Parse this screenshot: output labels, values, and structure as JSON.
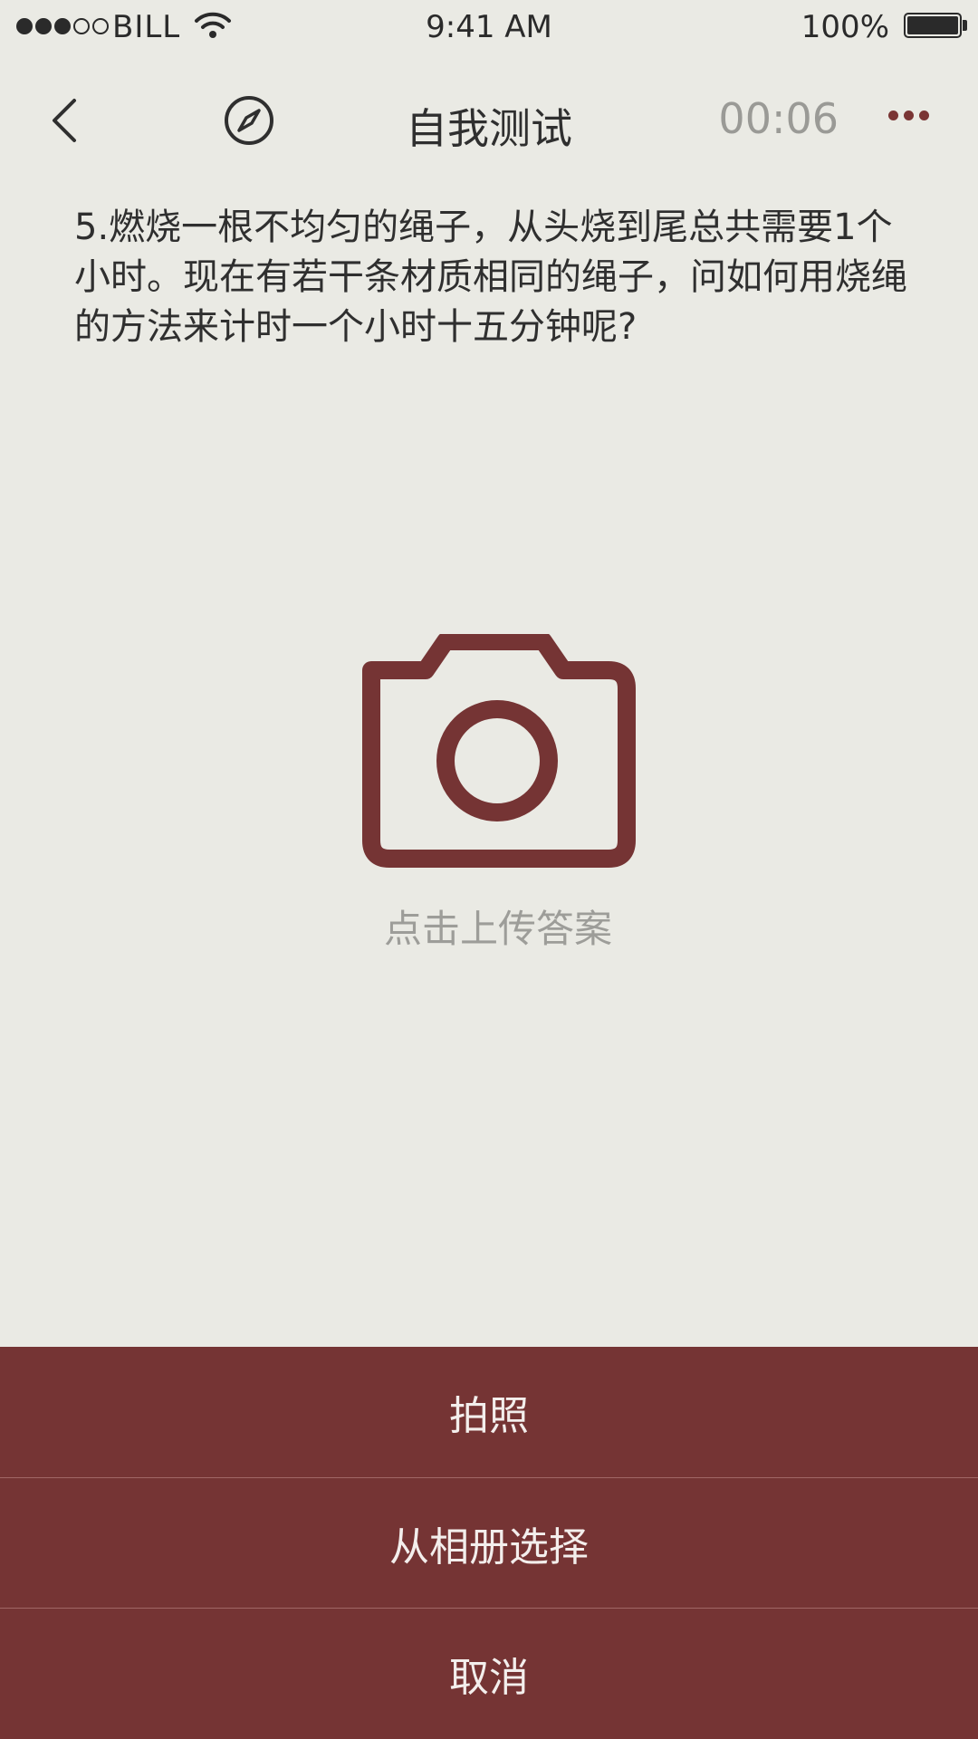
{
  "status_bar": {
    "carrier": "BILL",
    "signal_bars_filled": 3,
    "signal_bars_total": 5,
    "time": "9:41 AM",
    "battery_percent": "100%",
    "battery_level": 1.0
  },
  "nav": {
    "title": "自我测试",
    "timer": "00:06",
    "back_icon": "chevron-left-icon",
    "compass_icon": "compass-icon",
    "more_icon": "ellipsis-icon"
  },
  "question": {
    "text": "5.燃烧一根不均匀的绳子，从头烧到尾总共需要1个小时。现在有若干条材质相同的绳子，问如何用烧绳的方法来计时一个小时十五分钟呢?"
  },
  "upload": {
    "icon": "camera-icon",
    "label": "点击上传答案"
  },
  "action_sheet": {
    "items": [
      {
        "label": "拍照"
      },
      {
        "label": "从相册选择"
      },
      {
        "label": "取消"
      }
    ]
  },
  "colors": {
    "background": "#eaeae4",
    "accent": "#753434",
    "text": "#2f2f2f",
    "muted": "#9d9d99"
  }
}
